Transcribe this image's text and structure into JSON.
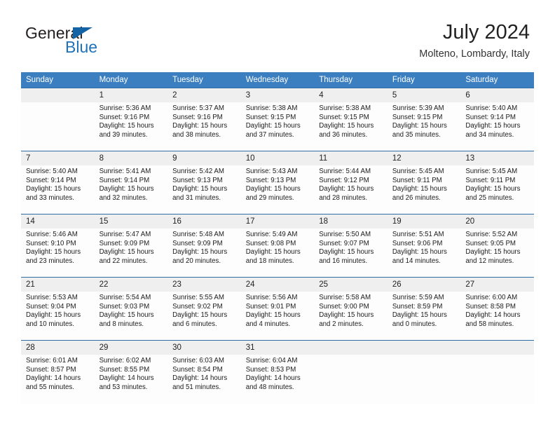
{
  "brand": {
    "name_part1": "General",
    "name_part2": "Blue",
    "logo_icon": "triangle-logo-icon"
  },
  "header": {
    "month_title": "July 2024",
    "location": "Molteno, Lombardy, Italy"
  },
  "calendar": {
    "weekday_headers": [
      "Sunday",
      "Monday",
      "Tuesday",
      "Wednesday",
      "Thursday",
      "Friday",
      "Saturday"
    ],
    "accent_color": "#3c7fc1",
    "border_color": "#2e6da4",
    "daynum_bg": "#efefef",
    "weeks": [
      [
        {
          "day": "",
          "sunrise": "",
          "sunset": "",
          "daylight_line1": "",
          "daylight_line2": ""
        },
        {
          "day": "1",
          "sunrise": "Sunrise: 5:36 AM",
          "sunset": "Sunset: 9:16 PM",
          "daylight_line1": "Daylight: 15 hours",
          "daylight_line2": "and 39 minutes."
        },
        {
          "day": "2",
          "sunrise": "Sunrise: 5:37 AM",
          "sunset": "Sunset: 9:16 PM",
          "daylight_line1": "Daylight: 15 hours",
          "daylight_line2": "and 38 minutes."
        },
        {
          "day": "3",
          "sunrise": "Sunrise: 5:38 AM",
          "sunset": "Sunset: 9:15 PM",
          "daylight_line1": "Daylight: 15 hours",
          "daylight_line2": "and 37 minutes."
        },
        {
          "day": "4",
          "sunrise": "Sunrise: 5:38 AM",
          "sunset": "Sunset: 9:15 PM",
          "daylight_line1": "Daylight: 15 hours",
          "daylight_line2": "and 36 minutes."
        },
        {
          "day": "5",
          "sunrise": "Sunrise: 5:39 AM",
          "sunset": "Sunset: 9:15 PM",
          "daylight_line1": "Daylight: 15 hours",
          "daylight_line2": "and 35 minutes."
        },
        {
          "day": "6",
          "sunrise": "Sunrise: 5:40 AM",
          "sunset": "Sunset: 9:14 PM",
          "daylight_line1": "Daylight: 15 hours",
          "daylight_line2": "and 34 minutes."
        }
      ],
      [
        {
          "day": "7",
          "sunrise": "Sunrise: 5:40 AM",
          "sunset": "Sunset: 9:14 PM",
          "daylight_line1": "Daylight: 15 hours",
          "daylight_line2": "and 33 minutes."
        },
        {
          "day": "8",
          "sunrise": "Sunrise: 5:41 AM",
          "sunset": "Sunset: 9:14 PM",
          "daylight_line1": "Daylight: 15 hours",
          "daylight_line2": "and 32 minutes."
        },
        {
          "day": "9",
          "sunrise": "Sunrise: 5:42 AM",
          "sunset": "Sunset: 9:13 PM",
          "daylight_line1": "Daylight: 15 hours",
          "daylight_line2": "and 31 minutes."
        },
        {
          "day": "10",
          "sunrise": "Sunrise: 5:43 AM",
          "sunset": "Sunset: 9:13 PM",
          "daylight_line1": "Daylight: 15 hours",
          "daylight_line2": "and 29 minutes."
        },
        {
          "day": "11",
          "sunrise": "Sunrise: 5:44 AM",
          "sunset": "Sunset: 9:12 PM",
          "daylight_line1": "Daylight: 15 hours",
          "daylight_line2": "and 28 minutes."
        },
        {
          "day": "12",
          "sunrise": "Sunrise: 5:45 AM",
          "sunset": "Sunset: 9:11 PM",
          "daylight_line1": "Daylight: 15 hours",
          "daylight_line2": "and 26 minutes."
        },
        {
          "day": "13",
          "sunrise": "Sunrise: 5:45 AM",
          "sunset": "Sunset: 9:11 PM",
          "daylight_line1": "Daylight: 15 hours",
          "daylight_line2": "and 25 minutes."
        }
      ],
      [
        {
          "day": "14",
          "sunrise": "Sunrise: 5:46 AM",
          "sunset": "Sunset: 9:10 PM",
          "daylight_line1": "Daylight: 15 hours",
          "daylight_line2": "and 23 minutes."
        },
        {
          "day": "15",
          "sunrise": "Sunrise: 5:47 AM",
          "sunset": "Sunset: 9:09 PM",
          "daylight_line1": "Daylight: 15 hours",
          "daylight_line2": "and 22 minutes."
        },
        {
          "day": "16",
          "sunrise": "Sunrise: 5:48 AM",
          "sunset": "Sunset: 9:09 PM",
          "daylight_line1": "Daylight: 15 hours",
          "daylight_line2": "and 20 minutes."
        },
        {
          "day": "17",
          "sunrise": "Sunrise: 5:49 AM",
          "sunset": "Sunset: 9:08 PM",
          "daylight_line1": "Daylight: 15 hours",
          "daylight_line2": "and 18 minutes."
        },
        {
          "day": "18",
          "sunrise": "Sunrise: 5:50 AM",
          "sunset": "Sunset: 9:07 PM",
          "daylight_line1": "Daylight: 15 hours",
          "daylight_line2": "and 16 minutes."
        },
        {
          "day": "19",
          "sunrise": "Sunrise: 5:51 AM",
          "sunset": "Sunset: 9:06 PM",
          "daylight_line1": "Daylight: 15 hours",
          "daylight_line2": "and 14 minutes."
        },
        {
          "day": "20",
          "sunrise": "Sunrise: 5:52 AM",
          "sunset": "Sunset: 9:05 PM",
          "daylight_line1": "Daylight: 15 hours",
          "daylight_line2": "and 12 minutes."
        }
      ],
      [
        {
          "day": "21",
          "sunrise": "Sunrise: 5:53 AM",
          "sunset": "Sunset: 9:04 PM",
          "daylight_line1": "Daylight: 15 hours",
          "daylight_line2": "and 10 minutes."
        },
        {
          "day": "22",
          "sunrise": "Sunrise: 5:54 AM",
          "sunset": "Sunset: 9:03 PM",
          "daylight_line1": "Daylight: 15 hours",
          "daylight_line2": "and 8 minutes."
        },
        {
          "day": "23",
          "sunrise": "Sunrise: 5:55 AM",
          "sunset": "Sunset: 9:02 PM",
          "daylight_line1": "Daylight: 15 hours",
          "daylight_line2": "and 6 minutes."
        },
        {
          "day": "24",
          "sunrise": "Sunrise: 5:56 AM",
          "sunset": "Sunset: 9:01 PM",
          "daylight_line1": "Daylight: 15 hours",
          "daylight_line2": "and 4 minutes."
        },
        {
          "day": "25",
          "sunrise": "Sunrise: 5:58 AM",
          "sunset": "Sunset: 9:00 PM",
          "daylight_line1": "Daylight: 15 hours",
          "daylight_line2": "and 2 minutes."
        },
        {
          "day": "26",
          "sunrise": "Sunrise: 5:59 AM",
          "sunset": "Sunset: 8:59 PM",
          "daylight_line1": "Daylight: 15 hours",
          "daylight_line2": "and 0 minutes."
        },
        {
          "day": "27",
          "sunrise": "Sunrise: 6:00 AM",
          "sunset": "Sunset: 8:58 PM",
          "daylight_line1": "Daylight: 14 hours",
          "daylight_line2": "and 58 minutes."
        }
      ],
      [
        {
          "day": "28",
          "sunrise": "Sunrise: 6:01 AM",
          "sunset": "Sunset: 8:57 PM",
          "daylight_line1": "Daylight: 14 hours",
          "daylight_line2": "and 55 minutes."
        },
        {
          "day": "29",
          "sunrise": "Sunrise: 6:02 AM",
          "sunset": "Sunset: 8:55 PM",
          "daylight_line1": "Daylight: 14 hours",
          "daylight_line2": "and 53 minutes."
        },
        {
          "day": "30",
          "sunrise": "Sunrise: 6:03 AM",
          "sunset": "Sunset: 8:54 PM",
          "daylight_line1": "Daylight: 14 hours",
          "daylight_line2": "and 51 minutes."
        },
        {
          "day": "31",
          "sunrise": "Sunrise: 6:04 AM",
          "sunset": "Sunset: 8:53 PM",
          "daylight_line1": "Daylight: 14 hours",
          "daylight_line2": "and 48 minutes."
        },
        {
          "day": "",
          "sunrise": "",
          "sunset": "",
          "daylight_line1": "",
          "daylight_line2": ""
        },
        {
          "day": "",
          "sunrise": "",
          "sunset": "",
          "daylight_line1": "",
          "daylight_line2": ""
        },
        {
          "day": "",
          "sunrise": "",
          "sunset": "",
          "daylight_line1": "",
          "daylight_line2": ""
        }
      ]
    ]
  }
}
